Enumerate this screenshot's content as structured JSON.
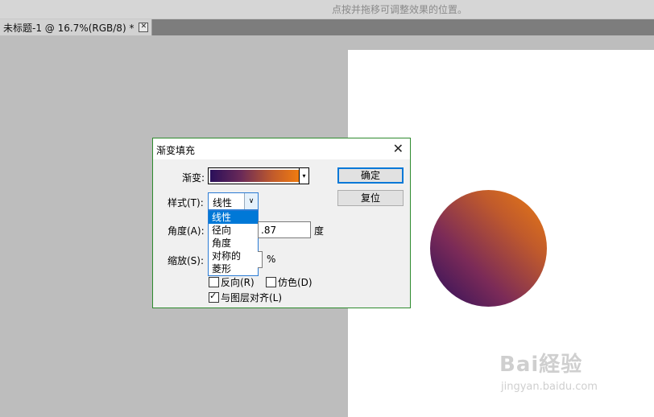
{
  "hint_bar": {
    "text": "点按并拖移可调整效果的位置。"
  },
  "document_tab": {
    "title": "未标题-1 @ 16.7%(RGB/8) *",
    "close_glyph": "✕"
  },
  "watermark": {
    "line1": "Bai経验",
    "line2": "jingyan.baidu.com"
  },
  "dialog": {
    "title": "渐变填充",
    "close_glyph": "✕",
    "gradient_label": "渐变:",
    "gradient_colors": [
      "#2a0f5a",
      "#c05a2c",
      "#f07c10"
    ],
    "style_label": "样式(T):",
    "style_value": "线性",
    "style_options": [
      "线性",
      "径向",
      "角度",
      "对称的",
      "菱形"
    ],
    "angle_label": "角度(A):",
    "angle_value": ".87",
    "angle_unit": "度",
    "scale_label": "缩放(S):",
    "scale_unit": "%",
    "reverse_label": "反向(R)",
    "reverse_checked": false,
    "dither_label": "仿色(D)",
    "dither_checked": false,
    "align_label": "与图层对齐(L)",
    "align_checked": true,
    "ok_label": "确定",
    "reset_label": "复位"
  }
}
